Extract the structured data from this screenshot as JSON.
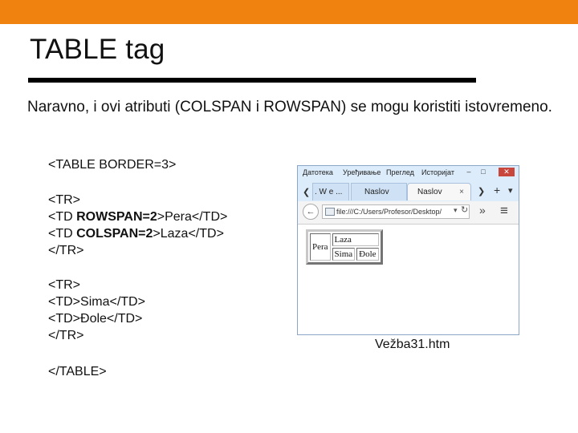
{
  "slide": {
    "title": "TABLE tag",
    "intro": "Naravno, i ovi atributi (COLSPAN i ROWSPAN) se mogu koristiti istovremeno.",
    "accent_color": "#f0820f"
  },
  "code": {
    "table_open": "<TABLE BORDER=3>",
    "row1_open": "<TR>",
    "td1_prefix": "<TD ",
    "td1_attr": "ROWSPAN=2",
    "td1_suffix": ">Pera</TD>",
    "td2_prefix": "<TD ",
    "td2_attr": "COLSPAN=2",
    "td2_suffix": ">Laza</TD>",
    "row1_close": "</TR>",
    "row2_open": "<TR>",
    "td3": "<TD>Sima</TD>",
    "td4": "<TD>Đole</TD>",
    "row2_close": "</TR>",
    "table_close": "</TABLE>"
  },
  "browser": {
    "menu": [
      "Датотека",
      "Уређивање",
      "Преглед",
      "Историјат"
    ],
    "tabs": [
      {
        "label": ". W e ...",
        "close": ""
      },
      {
        "label": "Naslov",
        "close": ""
      },
      {
        "label": "Naslov",
        "close": "×"
      }
    ],
    "new_tab": "+",
    "tab_menu": "▾",
    "url": "file:///C:/Users/Profesor/Desktop/",
    "overflow": "»",
    "menu_icon": "≡",
    "table": {
      "cell_pera": "Pera",
      "cell_laza": "Laza",
      "cell_sima": "Sima",
      "cell_dole": "Đole"
    }
  },
  "caption": "Vežba31.htm"
}
